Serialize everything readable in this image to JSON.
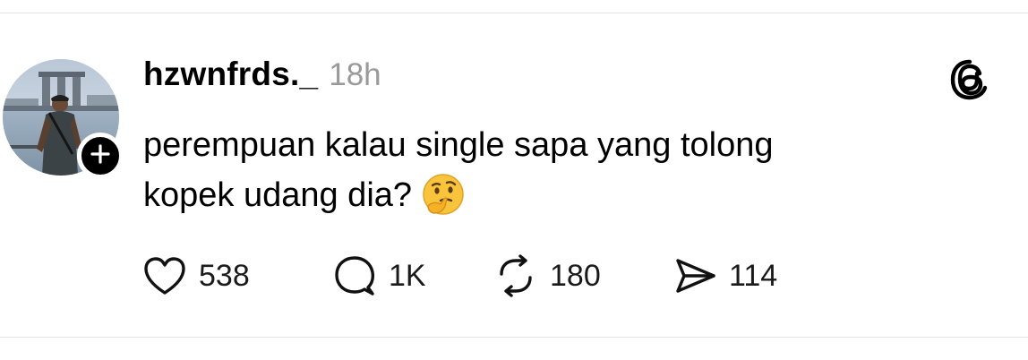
{
  "post": {
    "username": "hzwnfrds._",
    "timestamp": "18h",
    "text_line1": "perempuan kalau single sapa yang tolong",
    "text_line2": "kopek udang dia?",
    "emoji": "thinking-face"
  },
  "actions": {
    "likes": "538",
    "replies": "1K",
    "reposts": "180",
    "shares": "114"
  },
  "icons": {
    "like": "heart-icon",
    "reply": "speech-bubble-icon",
    "repost": "repost-arrows-icon",
    "share": "paper-plane-icon",
    "brand": "threads-logo-icon",
    "follow": "plus-icon"
  },
  "colors": {
    "text": "#000000",
    "muted": "#9a9a9a",
    "divider": "#e3e3e3",
    "emoji": "#f7c43c"
  }
}
